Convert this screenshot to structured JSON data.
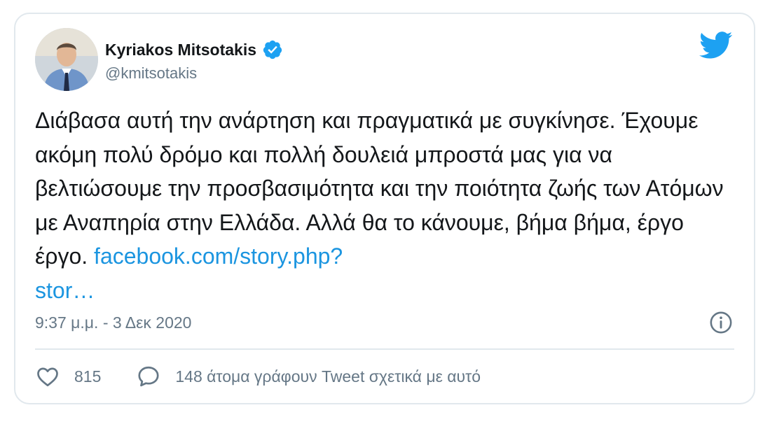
{
  "tweet": {
    "author_name": "Kyriakos Mitsotakis",
    "author_handle": "@kmitsotakis",
    "text": "Διάβασα αυτή την ανάρτηση και πραγματικά με συγκίνησε. Έχουμε ακόμη πολύ δρόμο και πολλή δουλειά μπροστά μας για να βελτιώσουμε την προσβασιμότητα και την ποιότητα ζωής των Ατόμων με Αναπηρία στην Ελλάδα. Αλλά θα το κάνουμε, βήμα βήμα, έργο έργο. ",
    "link_text": "facebook.com/story.php?\nstor…",
    "timestamp": "9:37 μ.μ. - 3 Δεκ 2020",
    "like_count": "815",
    "reply_label": "148 άτομα γράφουν Tweet σχετικά με αυτό"
  },
  "icons": {
    "verified": "verified-badge-icon",
    "brand": "twitter-bird-icon",
    "info": "info-icon",
    "like": "heart-icon",
    "reply": "speech-bubble-icon"
  },
  "colors": {
    "text": "#14171a",
    "secondary": "#657786",
    "link": "#1b95e0",
    "brand": "#1da1f2",
    "border": "#e1e8ed"
  }
}
